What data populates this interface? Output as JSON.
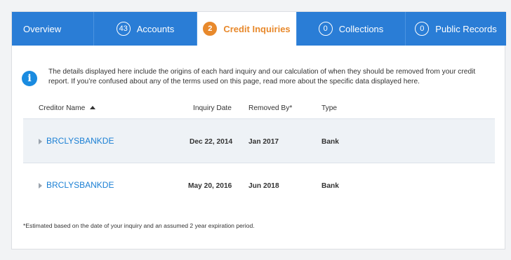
{
  "tabs": [
    {
      "label": "Overview",
      "count": ""
    },
    {
      "label": "Accounts",
      "count": "43"
    },
    {
      "label": "Credit Inquiries",
      "count": "2"
    },
    {
      "label": "Collections",
      "count": "0"
    },
    {
      "label": "Public Records",
      "count": "0"
    }
  ],
  "active_tab": "Credit Inquiries",
  "info": {
    "text": "The details displayed here include the origins of each hard inquiry and our calculation of when they should be removed from your credit report. If you’re confused about any of the terms used on this page, read more about the specific data displayed here."
  },
  "table": {
    "columns": [
      "Creditor Name",
      "Inquiry Date",
      "Removed By*",
      "Type"
    ],
    "rows": [
      {
        "creditor": "BRCLYSBANKDE",
        "inquiry_date": "Dec 22, 2014",
        "removed_by": "Jan 2017",
        "type": "Bank"
      },
      {
        "creditor": "BRCLYSBANKDE",
        "inquiry_date": "May 20, 2016",
        "removed_by": "Jun 2018",
        "type": "Bank"
      }
    ]
  },
  "footnote": "*Estimated based on the date of your inquiry and an assumed 2 year expiration period.",
  "colors": {
    "accent": "#2a7dd6",
    "active_tab_text": "#e8892c",
    "link": "#1a7fd4",
    "info_icon": "#1a8be0"
  }
}
